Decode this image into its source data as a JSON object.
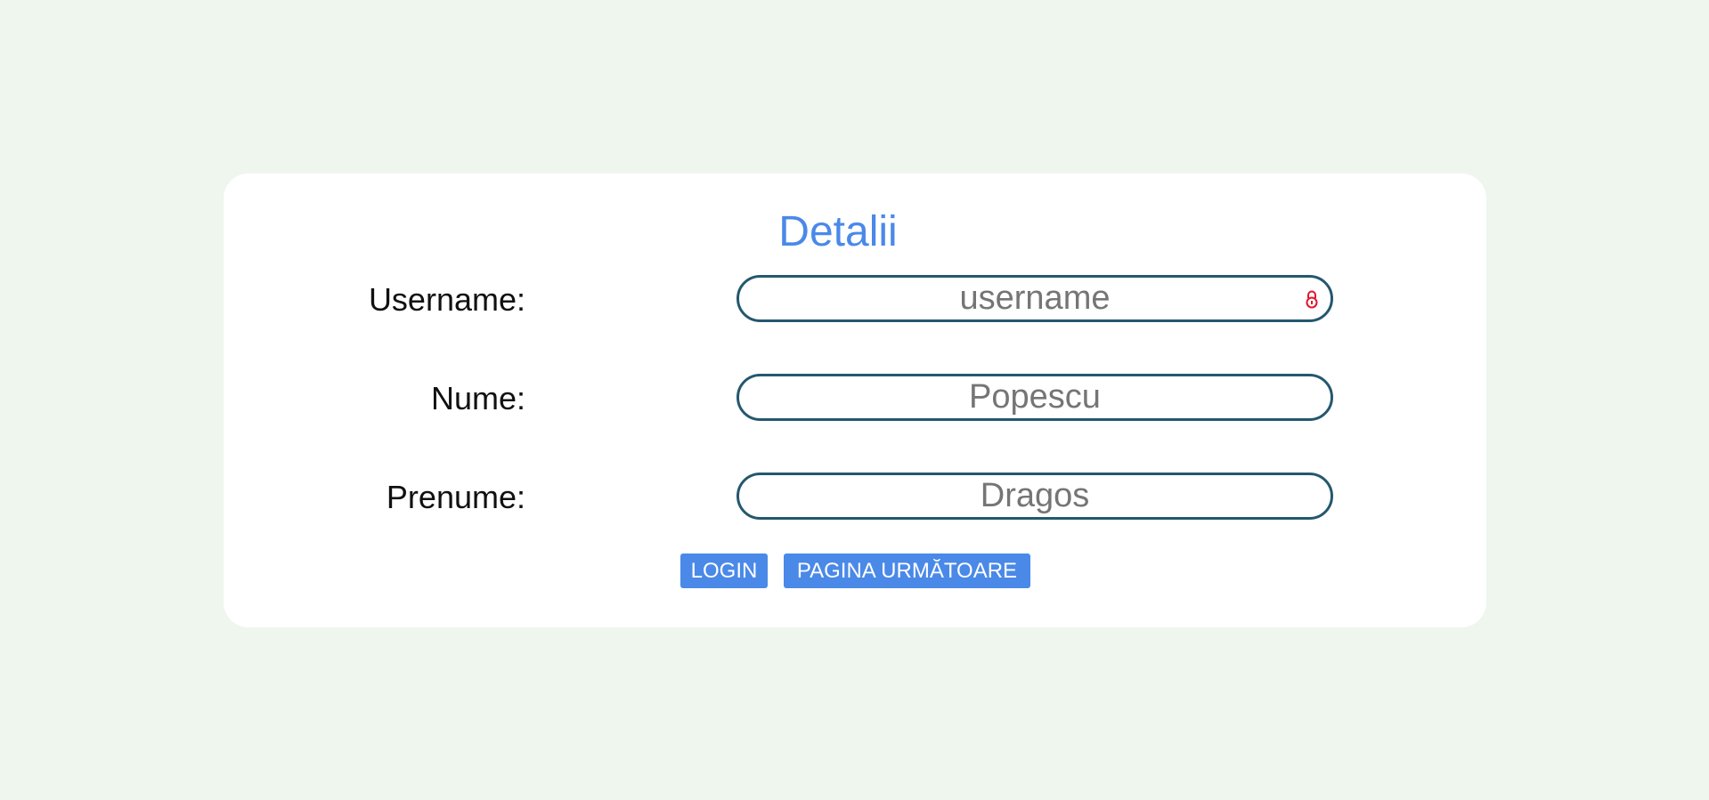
{
  "form": {
    "title": "Detalii",
    "fields": [
      {
        "label": "Username:",
        "placeholder": "username",
        "value": ""
      },
      {
        "label": "Nume:",
        "placeholder": "Popescu",
        "value": ""
      },
      {
        "label": "Prenume:",
        "placeholder": "Dragos",
        "value": ""
      }
    ],
    "buttons": {
      "login_label": "LOGIN",
      "next_label": "PAGINA URMĂTOARE"
    }
  },
  "colors": {
    "background": "#eef6ee",
    "accent": "#4a89e8",
    "field_border": "#24586e",
    "lock_icon": "#e0162f"
  },
  "icons": {
    "username_field_icon": "lock-icon"
  }
}
